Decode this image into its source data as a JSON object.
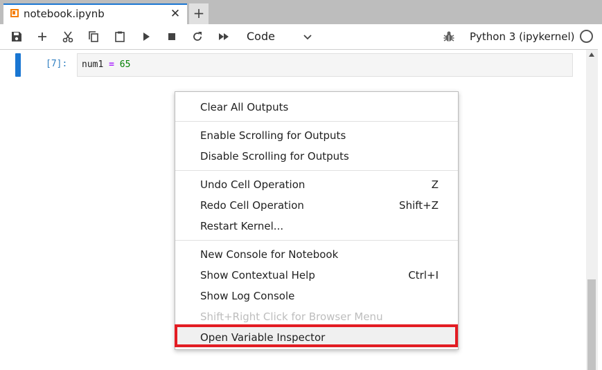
{
  "tab": {
    "title": "notebook.ipynb",
    "close_glyph": "✕",
    "add_glyph": "+"
  },
  "toolbar": {
    "cell_type": "Code",
    "kernel_name": "Python 3 (ipykernel)"
  },
  "cell": {
    "prompt": "[7]:",
    "code": {
      "var": "num1",
      "op": "=",
      "num": "65"
    }
  },
  "context_menu": {
    "groups": [
      [
        {
          "label": "Clear All Outputs",
          "shortcut": ""
        }
      ],
      [
        {
          "label": "Enable Scrolling for Outputs",
          "shortcut": ""
        },
        {
          "label": "Disable Scrolling for Outputs",
          "shortcut": ""
        }
      ],
      [
        {
          "label": "Undo Cell Operation",
          "shortcut": "Z"
        },
        {
          "label": "Redo Cell Operation",
          "shortcut": "Shift+Z"
        },
        {
          "label": "Restart Kernel...",
          "shortcut": ""
        }
      ],
      [
        {
          "label": "New Console for Notebook",
          "shortcut": ""
        },
        {
          "label": "Show Contextual Help",
          "shortcut": "Ctrl+I"
        },
        {
          "label": "Show Log Console",
          "shortcut": ""
        },
        {
          "label": "Shift+Right Click for Browser Menu",
          "shortcut": ""
        },
        {
          "label": "Open Variable Inspector",
          "shortcut": ""
        }
      ]
    ]
  },
  "colors": {
    "accent": "#1976d2",
    "highlight_box": "#e31c23",
    "notebook_icon": "#f57c00"
  }
}
